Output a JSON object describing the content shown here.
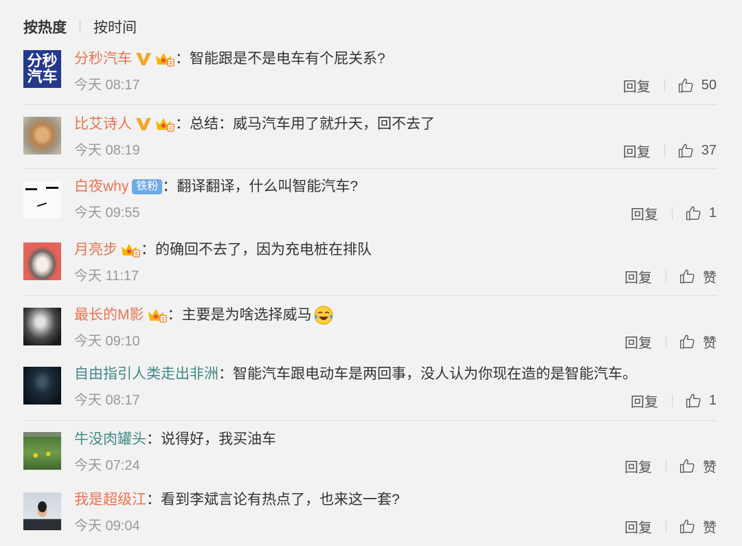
{
  "sort_tabs": {
    "hot": "按热度",
    "time": "按时间"
  },
  "colon": "：",
  "reply_label": "回复",
  "colors": {
    "background": "#f2f2f2",
    "name_orange": "#eb7350",
    "name_teal": "#3f8a84",
    "text": "#333333",
    "time": "#999999",
    "fan_badge": "#6ea9e8",
    "verified_v": "#f5a623"
  },
  "comments": [
    {
      "user": "分秒汽车",
      "name_color": "#eb7350",
      "avatar_text": [
        "分秒",
        "汽车"
      ],
      "badges": [
        "verified-v-icon",
        "member-crown-icon"
      ],
      "text": "智能跟是不是电车有个屁关系?",
      "time": "今天 08:17",
      "likes": "50"
    },
    {
      "user": "比艾诗人",
      "name_color": "#eb7350",
      "badges": [
        "verified-v-icon",
        "member-crown-icon"
      ],
      "text": "总结：威马汽车用了就升天，回不去了",
      "time": "今天 08:19",
      "likes": "37"
    },
    {
      "user": "白夜why",
      "name_color": "#eb7350",
      "fan_badge": "铁粉",
      "text": "翻译翻译，什么叫智能汽车?",
      "time": "今天 09:55",
      "likes": "1"
    },
    {
      "user": "月亮步",
      "name_color": "#eb7350",
      "badges": [
        "member-crown-icon"
      ],
      "text": "的确回不去了，因为充电桩在排队",
      "time": "今天 11:17",
      "likes": "赞"
    },
    {
      "user": "最长的M影",
      "name_color": "#eb7350",
      "badges": [
        "member-crown-icon"
      ],
      "text": "主要是为啥选择威马",
      "emoji": "laughing-tears-icon",
      "time": "今天 09:10",
      "likes": "赞"
    },
    {
      "user": "自由指引人类走出非洲",
      "name_color": "#3f8a84",
      "text": "智能汽车跟电动车是两回事，没人认为你现在造的是智能汽车。",
      "time": "今天 08:17",
      "likes": "1"
    },
    {
      "user": "牛没肉罐头",
      "name_color": "#3f8a84",
      "text": "说得好，我买油车",
      "time": "今天 07:24",
      "likes": "赞"
    },
    {
      "user": "我是超级江",
      "name_color": "#eb7350",
      "text": "看到李斌言论有热点了，也来这一套?",
      "time": "今天 09:04",
      "likes": "赞"
    }
  ]
}
